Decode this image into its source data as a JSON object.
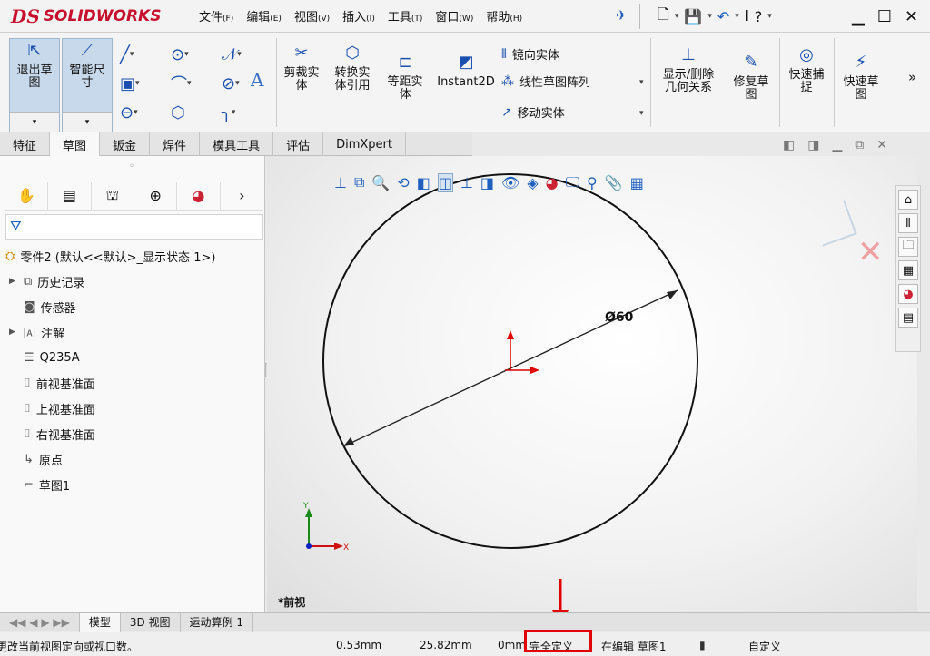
{
  "app": {
    "brand": "SOLIDWORKS",
    "brand_prefix": "DS"
  },
  "menu": [
    {
      "label": "文件",
      "key": "(F)"
    },
    {
      "label": "编辑",
      "key": "(E)"
    },
    {
      "label": "视图",
      "key": "(V)"
    },
    {
      "label": "插入",
      "key": "(I)"
    },
    {
      "label": "工具",
      "key": "(T)"
    },
    {
      "label": "窗口",
      "key": "(W)"
    },
    {
      "label": "帮助",
      "key": "(H)"
    }
  ],
  "quick_access": {
    "new_icon": "new-document-icon",
    "save_icon": "save-icon",
    "undo_icon": "undo-icon",
    "help_label": "?"
  },
  "ribbon": {
    "exit_sketch": "退出草图",
    "smart_dimension": "智能尺寸",
    "trim": "剪裁实体",
    "convert": "转换实体引用",
    "offset": "等距实体",
    "instant2d": "Instant2D",
    "mirror": "镜向实体",
    "linear_pattern": "线性草图阵列",
    "move": "移动实体",
    "show_relations": "显示/删除几何关系",
    "repair": "修复草图",
    "quick_snap": "快速捕捉",
    "rapid_sketch": "快速草图",
    "more": "»"
  },
  "tabs": [
    "特征",
    "草图",
    "钣金",
    "焊件",
    "模具工具",
    "评估",
    "DimXpert"
  ],
  "active_tab": "草图",
  "tree": {
    "root": "零件2  (默认<<默认>_显示状态 1>)",
    "items": [
      "历史记录",
      "传感器",
      "注解",
      "Q235A",
      "前视基准面",
      "上视基准面",
      "右视基准面",
      "原点",
      "草图1"
    ]
  },
  "viewport": {
    "dimension": "Ø60",
    "view_name": "*前视",
    "axis_x": "X",
    "axis_y": "Y",
    "circle_color": "#111111",
    "origin_color": "#e00000"
  },
  "bottom_tabs": [
    "模型",
    "3D 视图",
    "运动算例 1"
  ],
  "status": {
    "hint": "更改当前视图定向或视口数。",
    "x": "0.53mm",
    "y": "25.82mm",
    "z": "0mm",
    "state": "完全定义",
    "editing": "在编辑 草图1",
    "custom": "自定义"
  },
  "colors": {
    "brand": "#c8102e",
    "highlight_box": "#e00000",
    "accent": "#1f5fbf"
  }
}
